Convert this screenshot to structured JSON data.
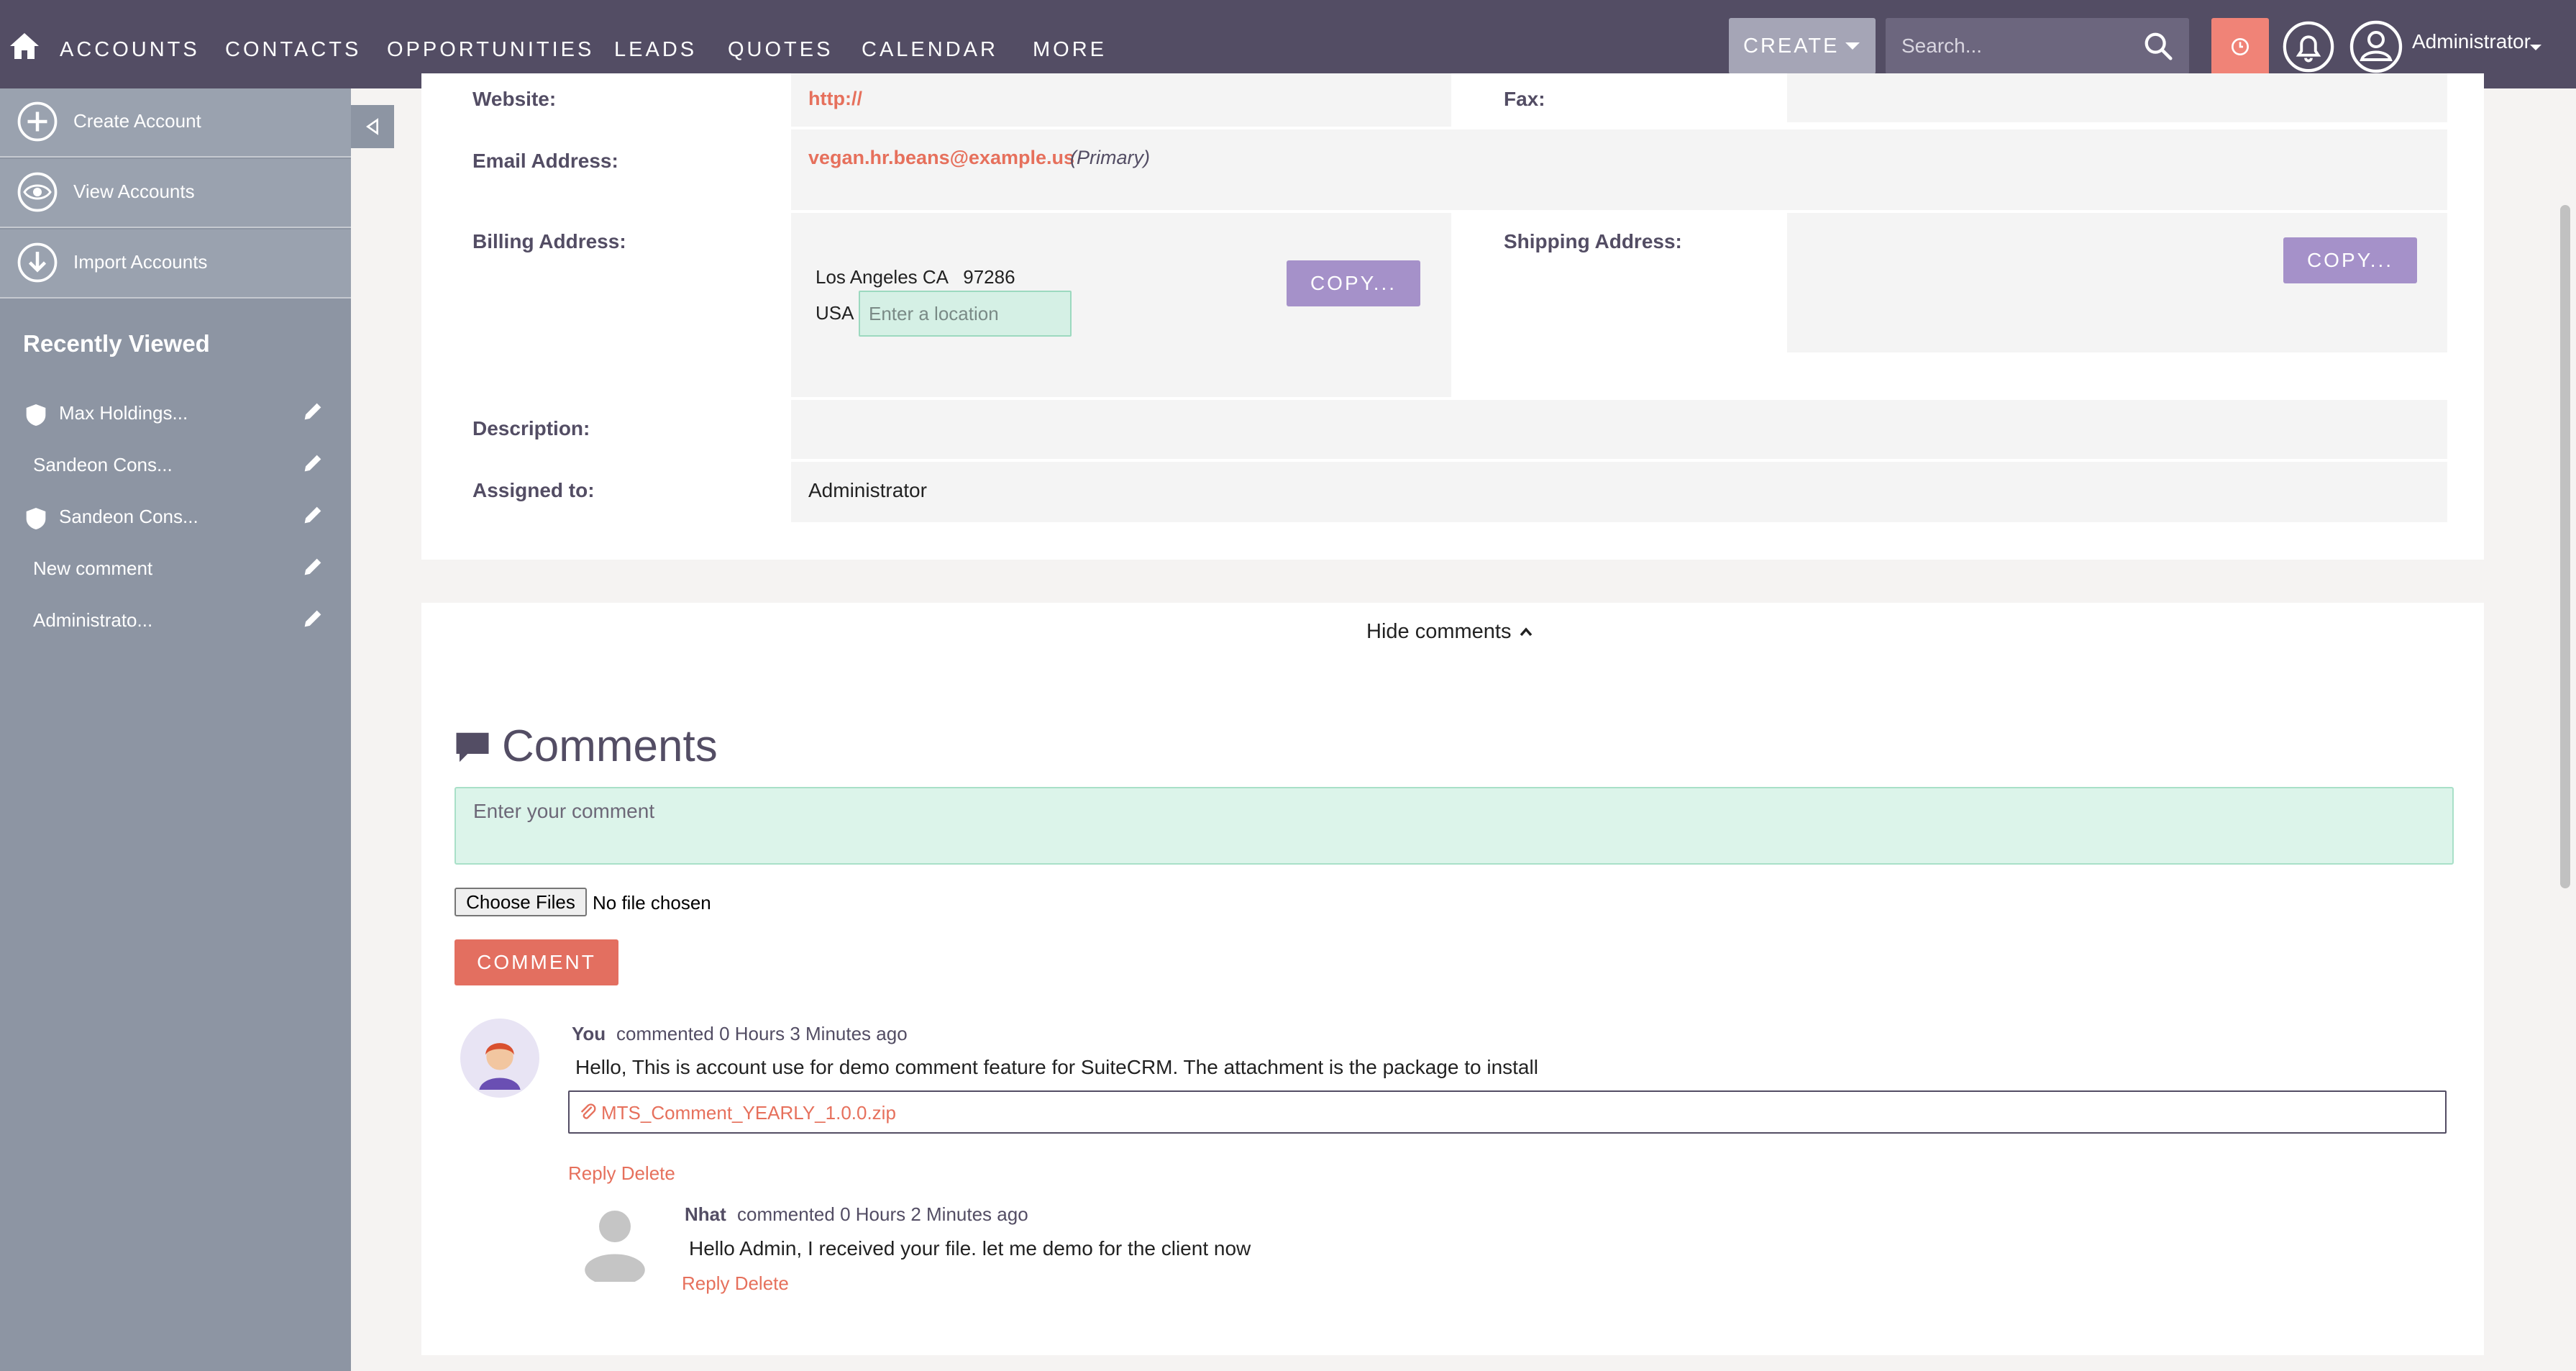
{
  "nav": {
    "items": [
      "ACCOUNTS",
      "CONTACTS",
      "OPPORTUNITIES",
      "LEADS",
      "QUOTES",
      "CALENDAR",
      "MORE"
    ],
    "create_label": "CREATE",
    "search_placeholder": "Search...",
    "user_label": "Administrator"
  },
  "sidebar": {
    "actions": [
      {
        "label": "Create Account",
        "icon": "plus-circle-icon"
      },
      {
        "label": "View Accounts",
        "icon": "eye-icon"
      },
      {
        "label": "Import Accounts",
        "icon": "download-icon"
      }
    ],
    "recently_viewed_title": "Recently Viewed",
    "recently_viewed": [
      {
        "label": "Max Holdings...",
        "icon": "shield-icon"
      },
      {
        "label": "Sandeon Cons...",
        "icon": ""
      },
      {
        "label": "Sandeon Cons...",
        "icon": "shield-icon"
      },
      {
        "label": "New comment",
        "icon": ""
      },
      {
        "label": "Administrato...",
        "icon": ""
      }
    ]
  },
  "detail": {
    "website_label": "Website:",
    "website_value": "http://",
    "fax_label": "Fax:",
    "email_label": "Email Address:",
    "email_value": "vegan.hr.beans@example.us",
    "email_tag": "(Primary)",
    "billing_label": "Billing Address:",
    "billing_line1": "Los Angeles CA   97286",
    "billing_country": "USA",
    "location_placeholder": "Enter a location",
    "copy_label": "COPY...",
    "shipping_label": "Shipping Address:",
    "description_label": "Description:",
    "assigned_label": "Assigned to:",
    "assigned_value": "Administrator"
  },
  "comments": {
    "toggle_label": "Hide comments",
    "title": "Comments",
    "input_placeholder": "Enter your comment",
    "choose_files_label": "Choose Files",
    "no_file_label": "No file chosen",
    "submit_label": "COMMENT",
    "list": [
      {
        "author": "You",
        "meta": "commented 0 Hours 3 Minutes ago",
        "text": "Hello, This is account use for demo comment feature for SuiteCRM. The attachment is the package to install",
        "attachment": "MTS_Comment_YEARLY_1.0.0.zip",
        "actions": "Reply Delete"
      },
      {
        "author": "Nhat",
        "meta": "commented 0 Hours 2 Minutes ago",
        "text": "Hello Admin, I received your file. let me demo for the client now",
        "actions": "Reply Delete"
      }
    ]
  },
  "colors": {
    "nav_bg": "#534d64",
    "sidebar_bg": "#8d95a3",
    "accent": "#e36f60",
    "copy_button": "#a591c9"
  }
}
